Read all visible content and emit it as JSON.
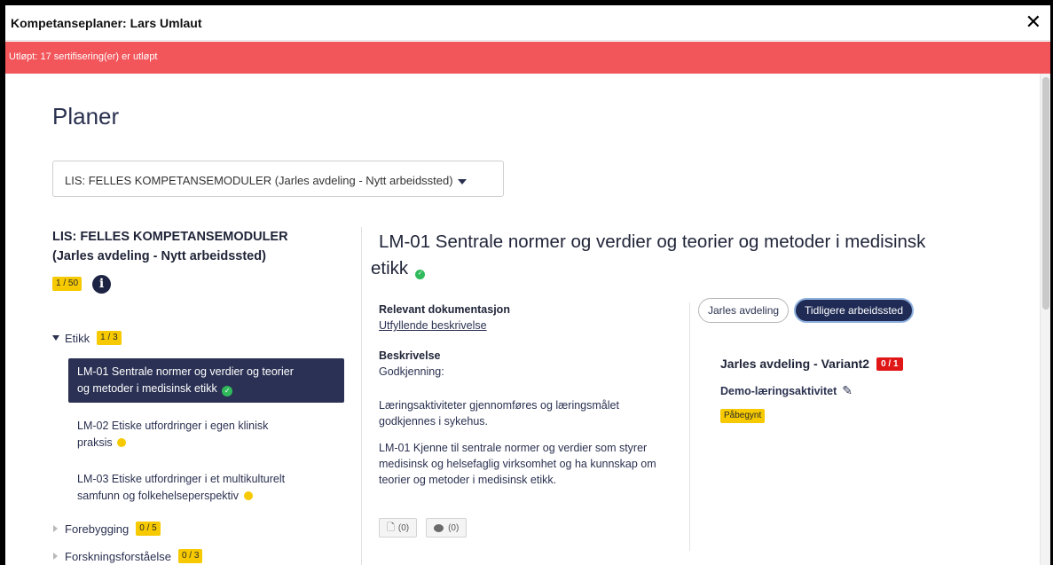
{
  "window": {
    "title": "Kompetanseplaner: Lars Umlaut",
    "close_glyph": "✕"
  },
  "alert": {
    "text": "Utløpt: 17 sertifisering(er) er utløpt",
    "color": "#f2555a"
  },
  "page": {
    "title": "Planer"
  },
  "plan_select": {
    "value": "LIS: FELLES KOMPETANSEMODULER (Jarles avdeling - Nytt arbeidssted)"
  },
  "plan": {
    "heading_line1": "LIS: FELLES KOMPETANSEMODULER",
    "heading_line2": "(Jarles avdeling - Nytt arbeidssted)",
    "progress": "1 / 50",
    "info_glyph": "i"
  },
  "tree": {
    "groups": [
      {
        "label": "Etikk",
        "progress": "1 / 3",
        "expanded": true,
        "modules": [
          {
            "line1": "LM-01 Sentrale normer og verdier og teorier",
            "line2": "og metoder i medisinsk etikk",
            "status": "complete",
            "active": true
          },
          {
            "line1": "LM-02 Etiske utfordringer i egen klinisk",
            "line2": "praksis",
            "status": "in-progress",
            "active": false
          },
          {
            "line1": "LM-03 Etiske utfordringer i et multikulturelt",
            "line2": "samfunn og folkehelseperspektiv",
            "status": "in-progress",
            "active": false
          }
        ]
      },
      {
        "label": "Forebygging",
        "progress": "0 / 5",
        "expanded": false
      },
      {
        "label": "Forskningsforståelse",
        "progress": "0 / 3",
        "expanded": false
      }
    ]
  },
  "module": {
    "title_line1": "LM-01 Sentrale normer og verdier og teorier og metoder i medisinsk",
    "title_line2": "etikk",
    "status": "complete",
    "relevant_doc_label": "Relevant dokumentasjon",
    "relevant_doc_link": "Utfyllende beskrivelse",
    "description_label": "Beskrivelse",
    "description_p1": "Godkjenning:",
    "description_p2": "Læringsaktiviteter gjennomføres og læringsmålet godkjennes i sykehus.",
    "description_p3": "LM-01 Kjenne til sentrale normer og verdier som styrer medisinsk og helsefaglig virksomhet og ha kunnskap om teorier og metoder i medisinsk etikk.",
    "documents_count": "(0)",
    "comments_count": "(0)"
  },
  "workplace_toggle": {
    "options": [
      "Jarles avdeling",
      "Tidligere arbeidssted"
    ],
    "selected": "Tidligere arbeidssted"
  },
  "variant": {
    "name": "Jarles avdeling - Variant2",
    "progress": "0 / 1",
    "activity": "Demo-læringsaktivitet",
    "activity_status": "Påbegynt"
  },
  "colors": {
    "primary": "#2b3154",
    "badge_yellow": "#f6c900",
    "badge_red": "#e01717",
    "success": "#2fba5b"
  }
}
